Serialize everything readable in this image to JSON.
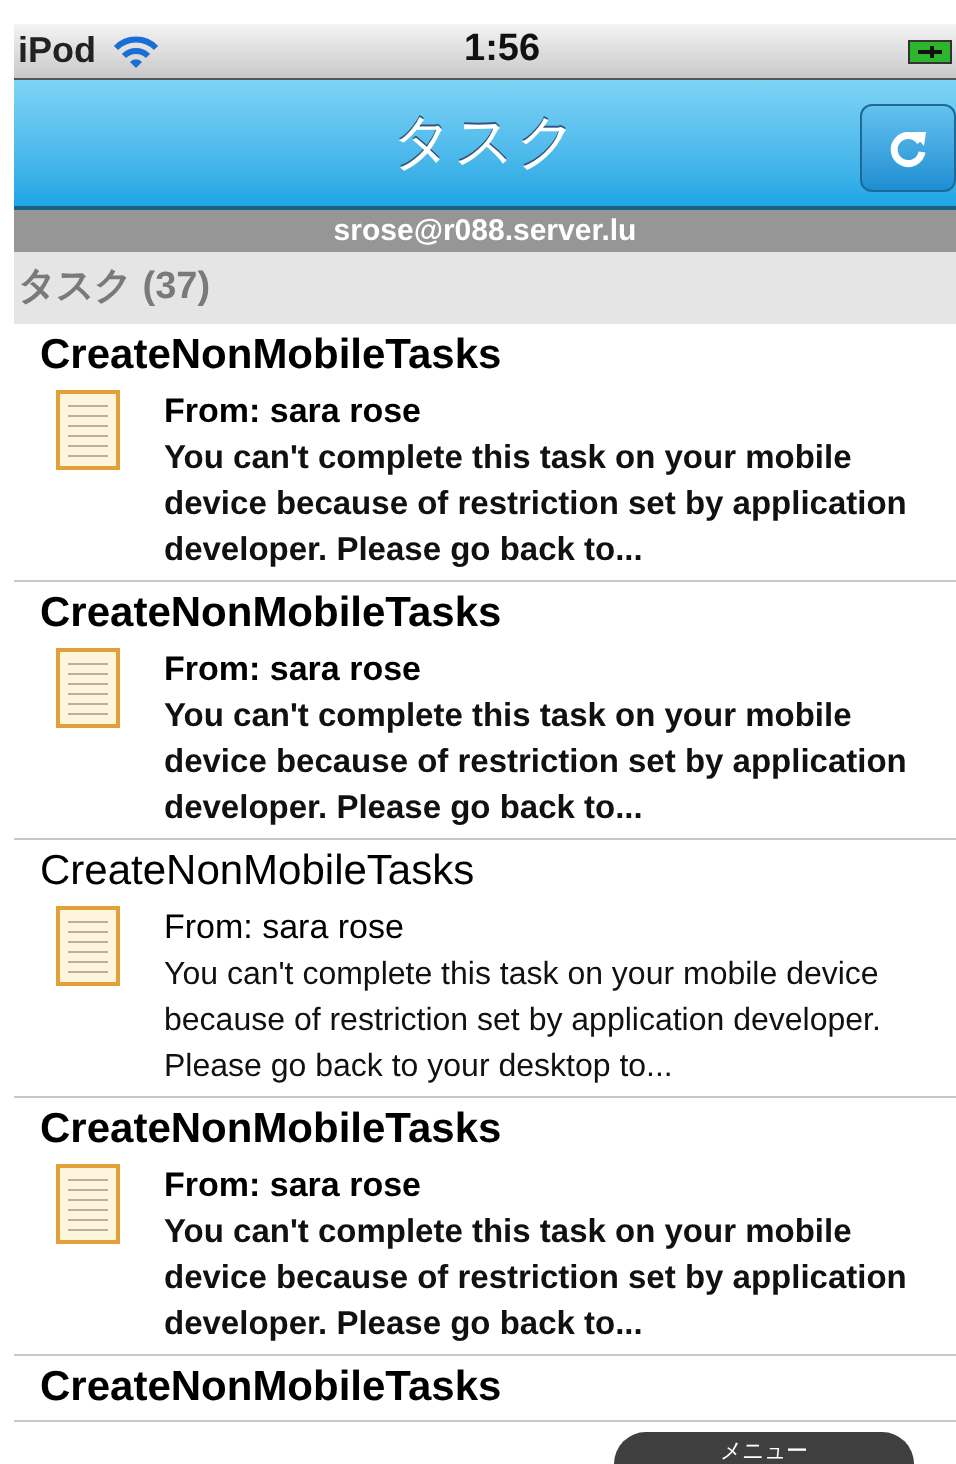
{
  "status_bar": {
    "carrier": "iPod",
    "time": "1:56"
  },
  "nav_bar": {
    "title": "タスク"
  },
  "account": "srose@r088.server.lu",
  "section": {
    "title": "タスク (37)"
  },
  "tasks": [
    {
      "title": "CreateNonMobileTasks",
      "from": "From: sara rose",
      "body": "You can't complete this task on your mobile device because of restriction set by application developer. Please go back to...",
      "unread": true
    },
    {
      "title": "CreateNonMobileTasks",
      "from": "From: sara rose",
      "body": "You can't complete this task on your mobile device because of restriction set by application developer. Please go back to...",
      "unread": true
    },
    {
      "title": "CreateNonMobileTasks",
      "from": "From: sara rose",
      "body": "You can't complete this task on your mobile device because of restriction set by application developer. Please go back to your desktop to...",
      "unread": false
    },
    {
      "title": "CreateNonMobileTasks",
      "from": "From: sara rose",
      "body": "You can't complete this task on your mobile device because of restriction set by application developer. Please go back to...",
      "unread": true
    },
    {
      "title": "CreateNonMobileTasks",
      "unread": true
    }
  ],
  "menu_tab": "メニュー"
}
